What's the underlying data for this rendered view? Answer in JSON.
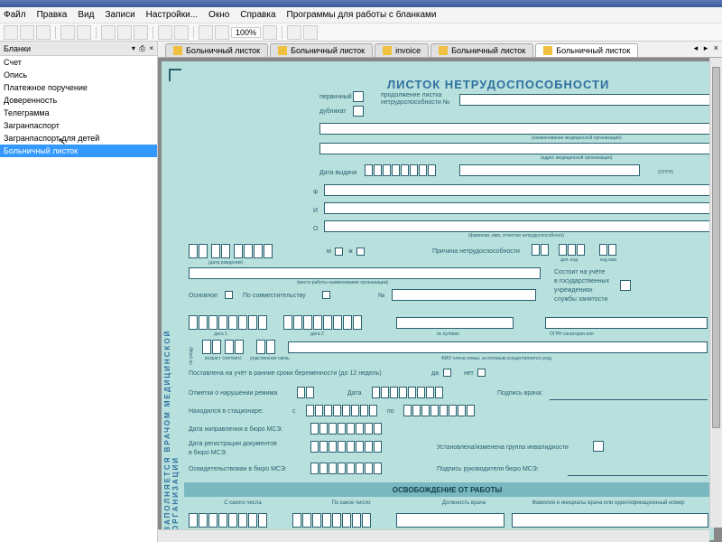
{
  "menu": [
    "Файл",
    "Правка",
    "Вид",
    "Записи",
    "Настройки...",
    "Окно",
    "Справка",
    "Программы для работы с бланками"
  ],
  "zoom": "100%",
  "sidebar": {
    "title": "Бланки",
    "items": [
      {
        "label": "Счет"
      },
      {
        "label": "Опись"
      },
      {
        "label": "Платежное поручение"
      },
      {
        "label": "Доверенность"
      },
      {
        "label": "Телеграмма"
      },
      {
        "label": "Загранпаспорт"
      },
      {
        "label": "Загранпаспорт для детей"
      },
      {
        "label": "Больничный листок",
        "selected": true
      }
    ]
  },
  "tabs": [
    {
      "label": "Больничный листок"
    },
    {
      "label": "Больничный листок"
    },
    {
      "label": "invoice"
    },
    {
      "label": "Больничный листок"
    },
    {
      "label": "Больничный листок",
      "active": true
    }
  ],
  "doc": {
    "title": "ЛИСТОК НЕТРУДОСПОСОБНОСТИ",
    "f": {
      "primary": "первичный",
      "dup": "дубликат",
      "cont1": "продолжение листка",
      "cont2": "нетрудоспособности №",
      "orgname": "(наименование медицинской организации)",
      "orgaddr": "(адрес медицинской организации)",
      "ogrn": "(ОГРН)",
      "issuedate": "Дата выдачи",
      "f_lab": "Ф",
      "i_lab": "И",
      "o_lab": "О",
      "fio_sub": "(фамилия, имя, отчество нетрудоспособного)",
      "birth": "(дата рождения)",
      "m": "м",
      "zh": "ж",
      "cause": "Причина нетрудоспособности",
      "cause_doc": "доп. код",
      "cause_chg": "код изм.",
      "workplace": "(место работы наименование организации)",
      "main": "Основное",
      "parttime": "По совместительству",
      "num": "№",
      "gov1": "Состоит на учёте",
      "gov2": "в государственных",
      "gov3": "учреждениях",
      "gov4": "службы занятости",
      "date1": "дата 1",
      "date2": "дата 2",
      "voucher": "№ путёвки",
      "ogrn_san": "ОГРН санатория или",
      "care": "по уходу",
      "age": "возраст (лет/мес)",
      "rel": "родственная связь",
      "fio_care": "ФИО члена семьи, за которым осуществляется уход",
      "preg": "Поставлена на учёт в ранние сроки беременности (до 12 недель)",
      "yes": "да",
      "no": "нет",
      "violation": "Отметки о нарушении режима",
      "dateL": "Дата",
      "doctor_sign": "Подпись врача:",
      "hospital": "Находился в стационаре:",
      "from": "с",
      "to": "по",
      "mse_ref": "Дата направления в бюро МСЭ:",
      "mse_reg1": "Дата регистрации документов",
      "mse_reg2": "в бюро МСЭ:",
      "mse_exam": "Освидетельствован в бюро МСЭ:",
      "disab": "Установлена/изменена группа инвалидности",
      "mse_head": "Подпись руководителя бюро МСЭ:",
      "release": "ОСВОБОЖДЕНИЕ ОТ РАБОТЫ",
      "col1": "С какого числа",
      "col2": "По какое число",
      "col3": "Должность врача",
      "col4": "Фамилия и инициалы врача или идентификационный номер"
    },
    "vert": "ЗАПОЛНЯЕТСЯ ВРАЧОМ МЕДИЦИНСКОЙ ОРГАНИЗАЦИИ"
  }
}
